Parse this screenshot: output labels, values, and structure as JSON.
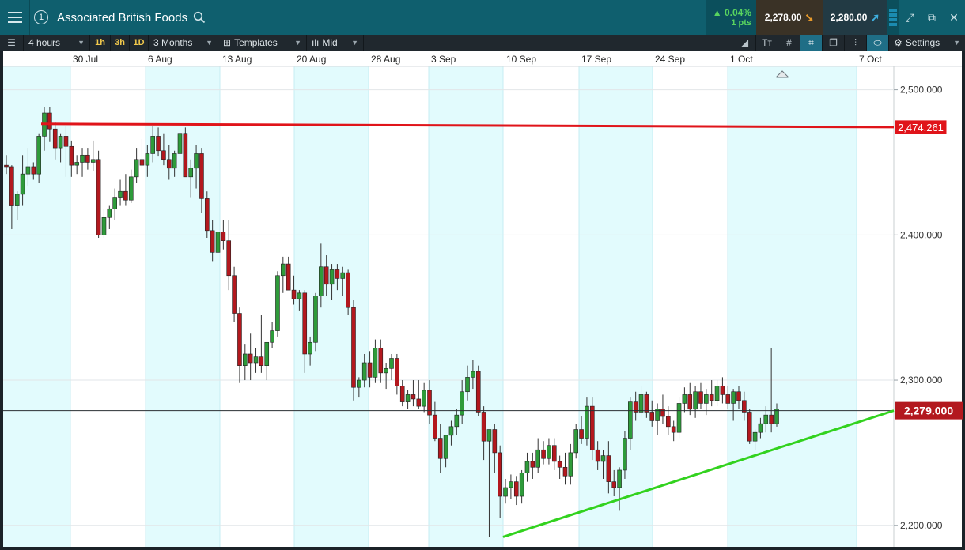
{
  "header": {
    "badge": "1",
    "title": "Associated British Foods",
    "change_pct": "▲ 0.04%",
    "change_pts": "1 pts",
    "sell_price": "2,278.00",
    "buy_price": "2,280.00"
  },
  "toolbar": {
    "interval": "4 hours",
    "quick_1": "1h",
    "quick_2": "3h",
    "quick_3": "1D",
    "range": "3 Months",
    "templates": "Templates",
    "price_type": "Mid",
    "settings": "Settings"
  },
  "colors": {
    "up_candle": "#2e9b3a",
    "down_candle": "#b3181e",
    "resistance_line": "#e0141a",
    "support_line": "#32d21e",
    "band_fill": "#e2fbfd"
  },
  "chart_data": {
    "type": "candlestick",
    "x_labels": [
      "30 Jul",
      "6 Aug",
      "13 Aug",
      "20 Aug",
      "28 Aug",
      "3 Sep",
      "10 Sep",
      "17 Sep",
      "24 Sep",
      "1 Oct",
      "7 Oct"
    ],
    "y_ticks": [
      "2,500.000",
      "2,400.000",
      "2,300.000",
      "2,200.000"
    ],
    "y_tick_values": [
      2500,
      2400,
      2300,
      2200
    ],
    "ylim": [
      2183,
      2527
    ],
    "current_price": 2279.0,
    "current_price_label": "2,279.000",
    "resistance": {
      "start_value": 2476.5,
      "end_value": 2474.261,
      "label": "2,474.261"
    },
    "support": {
      "start_value": 2192.0,
      "end_value": 2279.0
    },
    "candles": [
      [
        2448,
        2455,
        2442,
        2447
      ],
      [
        2447,
        2448,
        2404,
        2420
      ],
      [
        2420,
        2430,
        2410,
        2428
      ],
      [
        2428,
        2455,
        2420,
        2442
      ],
      [
        2442,
        2460,
        2434,
        2447
      ],
      [
        2447,
        2450,
        2438,
        2442
      ],
      [
        2442,
        2470,
        2436,
        2468
      ],
      [
        2468,
        2488,
        2458,
        2484
      ],
      [
        2484,
        2488,
        2464,
        2473
      ],
      [
        2473,
        2478,
        2452,
        2460
      ],
      [
        2460,
        2470,
        2450,
        2468
      ],
      [
        2468,
        2475,
        2440,
        2461
      ],
      [
        2461,
        2465,
        2440,
        2448
      ],
      [
        2448,
        2455,
        2442,
        2450
      ],
      [
        2450,
        2460,
        2440,
        2455
      ],
      [
        2455,
        2460,
        2445,
        2450
      ],
      [
        2450,
        2465,
        2444,
        2452
      ],
      [
        2452,
        2458,
        2398,
        2400
      ],
      [
        2400,
        2418,
        2398,
        2412
      ],
      [
        2412,
        2420,
        2404,
        2418
      ],
      [
        2418,
        2432,
        2410,
        2426
      ],
      [
        2426,
        2438,
        2420,
        2430
      ],
      [
        2430,
        2442,
        2420,
        2424
      ],
      [
        2424,
        2445,
        2422,
        2440
      ],
      [
        2440,
        2460,
        2436,
        2452
      ],
      [
        2452,
        2466,
        2445,
        2448
      ],
      [
        2448,
        2462,
        2440,
        2456
      ],
      [
        2456,
        2475,
        2450,
        2468
      ],
      [
        2468,
        2474,
        2454,
        2458
      ],
      [
        2458,
        2470,
        2448,
        2452
      ],
      [
        2452,
        2462,
        2438,
        2446
      ],
      [
        2446,
        2458,
        2440,
        2456
      ],
      [
        2456,
        2474,
        2450,
        2470
      ],
      [
        2470,
        2474,
        2440,
        2440
      ],
      [
        2440,
        2452,
        2426,
        2446
      ],
      [
        2446,
        2462,
        2432,
        2456
      ],
      [
        2456,
        2460,
        2415,
        2425
      ],
      [
        2425,
        2430,
        2398,
        2403
      ],
      [
        2403,
        2410,
        2382,
        2388
      ],
      [
        2388,
        2406,
        2384,
        2402
      ],
      [
        2402,
        2410,
        2390,
        2396
      ],
      [
        2396,
        2410,
        2362,
        2372
      ],
      [
        2372,
        2378,
        2340,
        2346
      ],
      [
        2346,
        2350,
        2298,
        2310
      ],
      [
        2310,
        2325,
        2300,
        2318
      ],
      [
        2318,
        2332,
        2300,
        2312
      ],
      [
        2312,
        2322,
        2305,
        2316
      ],
      [
        2316,
        2345,
        2305,
        2310
      ],
      [
        2310,
        2322,
        2300,
        2326
      ],
      [
        2326,
        2340,
        2322,
        2334
      ],
      [
        2334,
        2375,
        2330,
        2372
      ],
      [
        2372,
        2385,
        2360,
        2380
      ],
      [
        2380,
        2385,
        2365,
        2362
      ],
      [
        2362,
        2372,
        2352,
        2356
      ],
      [
        2356,
        2362,
        2348,
        2360
      ],
      [
        2360,
        2362,
        2305,
        2318
      ],
      [
        2318,
        2330,
        2310,
        2326
      ],
      [
        2326,
        2360,
        2320,
        2358
      ],
      [
        2358,
        2394,
        2350,
        2378
      ],
      [
        2378,
        2386,
        2358,
        2366
      ],
      [
        2366,
        2380,
        2355,
        2376
      ],
      [
        2376,
        2380,
        2362,
        2370
      ],
      [
        2370,
        2378,
        2358,
        2374
      ],
      [
        2374,
        2376,
        2345,
        2350
      ],
      [
        2350,
        2355,
        2286,
        2295
      ],
      [
        2295,
        2302,
        2288,
        2300
      ],
      [
        2300,
        2318,
        2295,
        2312
      ],
      [
        2312,
        2320,
        2295,
        2302
      ],
      [
        2302,
        2328,
        2298,
        2322
      ],
      [
        2322,
        2328,
        2298,
        2305
      ],
      [
        2305,
        2312,
        2294,
        2308
      ],
      [
        2308,
        2318,
        2300,
        2315
      ],
      [
        2315,
        2318,
        2290,
        2296
      ],
      [
        2296,
        2300,
        2282,
        2285
      ],
      [
        2285,
        2293,
        2280,
        2290
      ],
      [
        2290,
        2300,
        2282,
        2287
      ],
      [
        2287,
        2300,
        2280,
        2282
      ],
      [
        2282,
        2298,
        2278,
        2293
      ],
      [
        2293,
        2300,
        2270,
        2276
      ],
      [
        2276,
        2285,
        2258,
        2260
      ],
      [
        2260,
        2270,
        2236,
        2246
      ],
      [
        2246,
        2262,
        2240,
        2262
      ],
      [
        2262,
        2272,
        2255,
        2268
      ],
      [
        2268,
        2280,
        2262,
        2276
      ],
      [
        2276,
        2300,
        2270,
        2292
      ],
      [
        2292,
        2310,
        2286,
        2302
      ],
      [
        2302,
        2314,
        2294,
        2306
      ],
      [
        2306,
        2310,
        2275,
        2278
      ],
      [
        2278,
        2282,
        2245,
        2258
      ],
      [
        2258,
        2265,
        2192,
        2266
      ],
      [
        2266,
        2270,
        2236,
        2250
      ],
      [
        2250,
        2255,
        2205,
        2220
      ],
      [
        2220,
        2232,
        2215,
        2226
      ],
      [
        2226,
        2235,
        2218,
        2230
      ],
      [
        2230,
        2234,
        2214,
        2220
      ],
      [
        2220,
        2238,
        2215,
        2236
      ],
      [
        2236,
        2250,
        2230,
        2244
      ],
      [
        2244,
        2250,
        2232,
        2240
      ],
      [
        2240,
        2260,
        2236,
        2252
      ],
      [
        2252,
        2258,
        2242,
        2246
      ],
      [
        2246,
        2260,
        2242,
        2255
      ],
      [
        2255,
        2260,
        2238,
        2244
      ],
      [
        2244,
        2248,
        2232,
        2240
      ],
      [
        2240,
        2250,
        2228,
        2234
      ],
      [
        2234,
        2256,
        2228,
        2250
      ],
      [
        2250,
        2270,
        2246,
        2266
      ],
      [
        2266,
        2275,
        2256,
        2260
      ],
      [
        2260,
        2288,
        2255,
        2282
      ],
      [
        2282,
        2288,
        2245,
        2252
      ],
      [
        2252,
        2258,
        2238,
        2244
      ],
      [
        2244,
        2252,
        2232,
        2248
      ],
      [
        2248,
        2258,
        2222,
        2230
      ],
      [
        2230,
        2238,
        2220,
        2226
      ],
      [
        2226,
        2240,
        2210,
        2238
      ],
      [
        2238,
        2265,
        2232,
        2260
      ],
      [
        2260,
        2288,
        2252,
        2285
      ],
      [
        2285,
        2292,
        2272,
        2278
      ],
      [
        2278,
        2296,
        2274,
        2290
      ],
      [
        2290,
        2292,
        2274,
        2278
      ],
      [
        2278,
        2286,
        2268,
        2272
      ],
      [
        2272,
        2284,
        2262,
        2280
      ],
      [
        2280,
        2290,
        2270,
        2275
      ],
      [
        2275,
        2282,
        2262,
        2268
      ],
      [
        2268,
        2272,
        2258,
        2264
      ],
      [
        2264,
        2288,
        2260,
        2284
      ],
      [
        2284,
        2295,
        2278,
        2290
      ],
      [
        2290,
        2298,
        2276,
        2280
      ],
      [
        2280,
        2296,
        2274,
        2292
      ],
      [
        2292,
        2298,
        2280,
        2284
      ],
      [
        2284,
        2294,
        2276,
        2290
      ],
      [
        2290,
        2300,
        2282,
        2286
      ],
      [
        2286,
        2300,
        2282,
        2296
      ],
      [
        2296,
        2302,
        2284,
        2290
      ],
      [
        2290,
        2296,
        2280,
        2284
      ],
      [
        2284,
        2294,
        2272,
        2292
      ],
      [
        2292,
        2296,
        2280,
        2286
      ],
      [
        2286,
        2292,
        2272,
        2278
      ],
      [
        2278,
        2280,
        2256,
        2258
      ],
      [
        2258,
        2266,
        2252,
        2264
      ],
      [
        2264,
        2274,
        2260,
        2270
      ],
      [
        2270,
        2282,
        2264,
        2276
      ],
      [
        2276,
        2322,
        2264,
        2270
      ],
      [
        2270,
        2284,
        2268,
        2280
      ]
    ]
  }
}
